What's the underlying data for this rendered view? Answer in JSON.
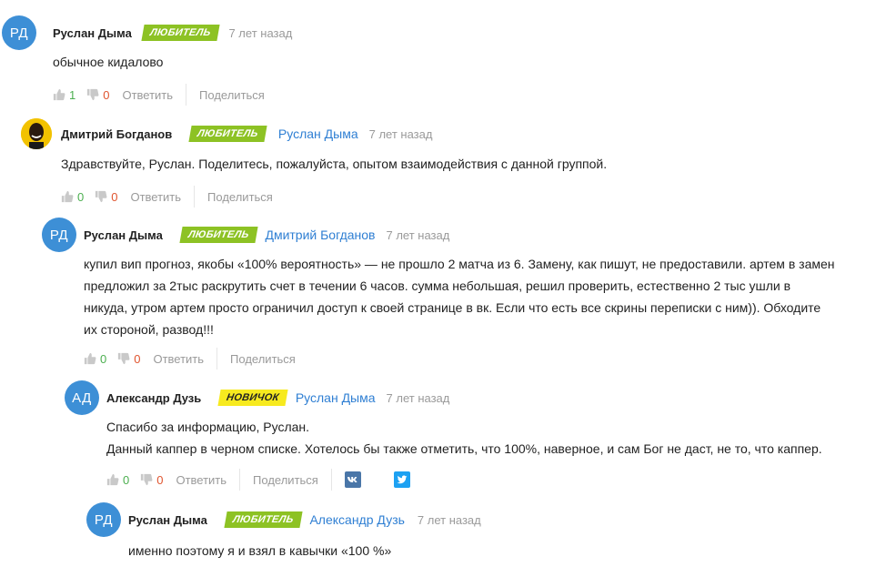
{
  "comments": [
    {
      "initials": "РД",
      "author": "Руслан Дыма",
      "badge": "ЛЮБИТЕЛЬ",
      "reply_to": "",
      "time": "7 лет назад",
      "text": [
        "обычное кидалово"
      ],
      "likes": "1",
      "dislikes": "0",
      "reply_label": "Ответить",
      "share_label": "Поделиться"
    },
    {
      "initials": "",
      "author": "Дмитрий Богданов",
      "badge": "ЛЮБИТЕЛЬ",
      "reply_to": "Руслан Дыма",
      "time": "7 лет назад",
      "text": [
        "Здравствуйте, Руслан. Поделитесь, пожалуйста, опытом взаимодействия с данной группой."
      ],
      "likes": "0",
      "dislikes": "0",
      "reply_label": "Ответить",
      "share_label": "Поделиться"
    },
    {
      "initials": "РД",
      "author": "Руслан Дыма",
      "badge": "ЛЮБИТЕЛЬ",
      "reply_to": "Дмитрий Богданов",
      "time": "7 лет назад",
      "text": [
        "купил вип прогноз, якобы «100% вероятность» — не прошло 2 матча из 6. Замену, как пишут, не предоставили. артем в замен",
        "предложил за 2тыс раскрутить счет в течении 6 часов. сумма небольшая, решил проверить, естественно 2 тыс ушли в",
        "никуда, утром артем просто ограничил доступ к своей странице в вк. Если что есть все скрины переписки с ним)). Обходите",
        "их стороной, развод!!!"
      ],
      "likes": "0",
      "dislikes": "0",
      "reply_label": "Ответить",
      "share_label": "Поделиться"
    },
    {
      "initials": "АД",
      "author": "Александр Дузь",
      "badge": "НОВИЧОК",
      "reply_to": "Руслан Дыма",
      "time": "7 лет назад",
      "text": [
        "Спасибо за информацию, Руслан.",
        "Данный каппер в черном списке. Хотелось бы также отметить, что 100%, наверное, и сам Бог не даст, не то, что каппер."
      ],
      "likes": "0",
      "dislikes": "0",
      "reply_label": "Ответить",
      "share_label": "Поделиться"
    },
    {
      "initials": "РД",
      "author": "Руслан Дыма",
      "badge": "ЛЮБИТЕЛЬ",
      "reply_to": "Александр Дузь",
      "time": "7 лет назад",
      "text": [
        "именно поэтому я и взял в кавычки «100 %»"
      ]
    }
  ],
  "colors": {
    "avatar": "#3d8fd6",
    "badge_amateur": "#8dc224",
    "badge_novice": "#f7ea1f",
    "link": "#2f7fd3",
    "like": "#4caf50",
    "dislike": "#e0552f"
  },
  "icons": [
    "thumbs-up-icon",
    "thumbs-down-icon",
    "vk-icon",
    "twitter-icon"
  ]
}
